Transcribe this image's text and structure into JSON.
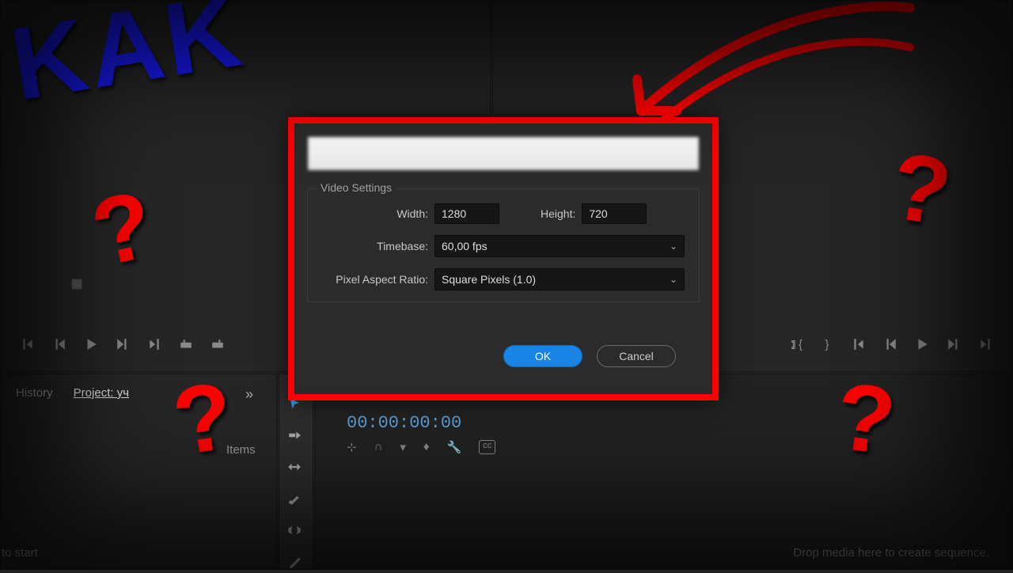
{
  "annotations": {
    "headline": "KAK",
    "question_mark": "?",
    "arrow_color": "#ff0000"
  },
  "dialog": {
    "video_settings_legend": "Video Settings",
    "width_label": "Width:",
    "width_value": "1280",
    "height_label": "Height:",
    "height_value": "720",
    "timebase_label": "Timebase:",
    "timebase_value": "60,00 fps",
    "par_label": "Pixel Aspect Ratio:",
    "par_value": "Square Pixels (1.0)",
    "ok_label": "OK",
    "cancel_label": "Cancel"
  },
  "bottom_left": {
    "tab_history": "History",
    "tab_project": "Project: уч",
    "more": "»",
    "items_label": "Items",
    "to_start": "to start"
  },
  "timeline": {
    "timecode": "00:00:00:00",
    "drop_hint": "Drop media here to create sequence."
  }
}
